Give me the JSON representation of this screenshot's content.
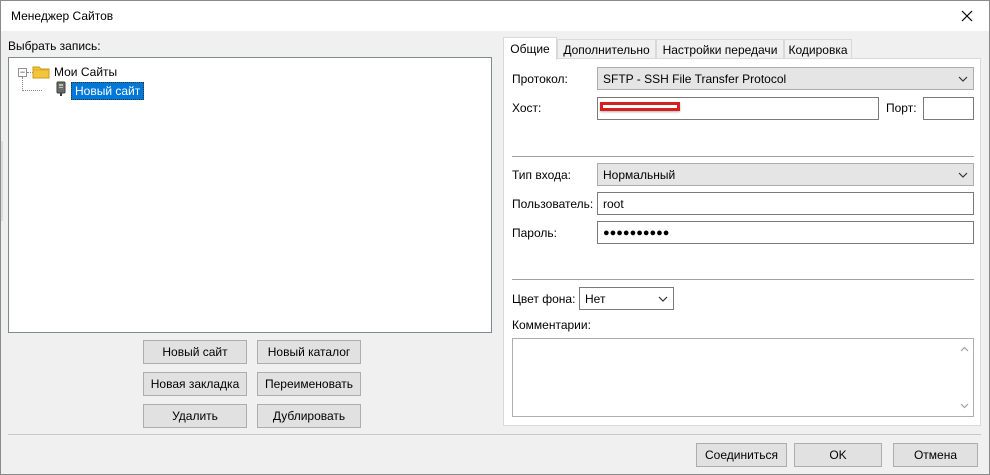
{
  "window": {
    "title": "Менеджер Сайтов"
  },
  "left": {
    "label": "Выбрать запись:",
    "tree": {
      "root_label": "Мои Сайты",
      "site_label": "Новый сайт"
    },
    "buttons": {
      "new_site": "Новый сайт",
      "new_folder": "Новый каталог",
      "new_bookmark": "Новая закладка",
      "rename": "Переименовать",
      "delete": "Удалить",
      "duplicate": "Дублировать"
    }
  },
  "tabs": [
    {
      "label": "Общие",
      "active": true
    },
    {
      "label": "Дополнительно",
      "active": false
    },
    {
      "label": "Настройки передачи",
      "active": false
    },
    {
      "label": "Кодировка",
      "active": false
    }
  ],
  "general": {
    "protocol_label": "Протокол:",
    "protocol_value": "SFTP - SSH File Transfer Protocol",
    "host_label": "Хост:",
    "host_value": "",
    "port_label": "Порт:",
    "port_value": "",
    "logon_type_label": "Тип входа:",
    "logon_type_value": "Нормальный",
    "user_label": "Пользователь:",
    "user_value": "root",
    "password_label": "Пароль:",
    "password_value": "●●●●●●●●●●",
    "bg_color_label": "Цвет фона:",
    "bg_color_value": "Нет",
    "comments_label": "Комментарии:",
    "comments_value": ""
  },
  "footer": {
    "connect": "Соединиться",
    "ok": "OK",
    "cancel": "Отмена"
  },
  "colors": {
    "selection": "#0078d7",
    "redaction": "#d42020",
    "folder": "#f3c53d"
  },
  "icons": {
    "close": "close-icon",
    "folder": "folder-icon",
    "site": "site-icon",
    "chevron": "chevron-down-icon"
  }
}
